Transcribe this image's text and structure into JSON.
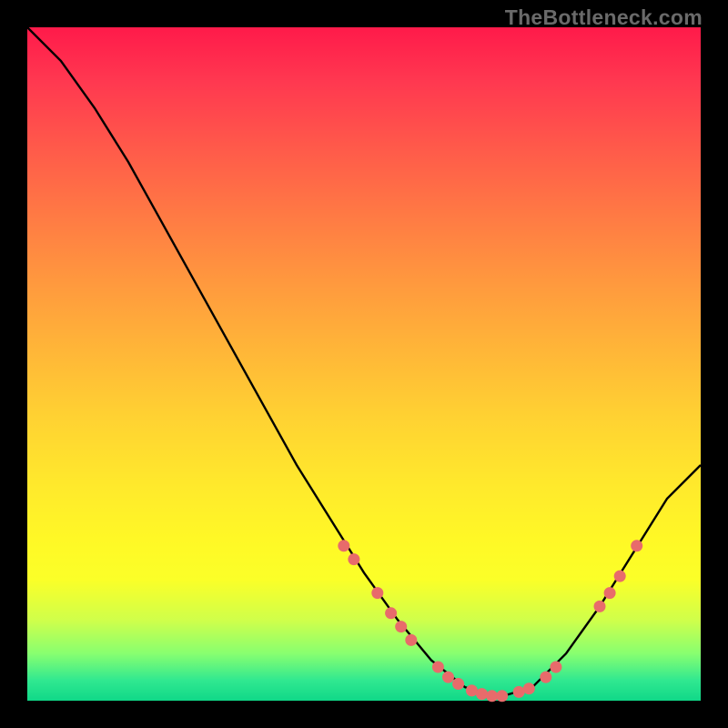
{
  "watermark": "TheBottleneck.com",
  "chart_data": {
    "type": "line",
    "title": "",
    "xlabel": "",
    "ylabel": "",
    "xlim": [
      0,
      100
    ],
    "ylim": [
      0,
      100
    ],
    "curve": [
      {
        "x": 0,
        "y": 100
      },
      {
        "x": 5,
        "y": 95
      },
      {
        "x": 10,
        "y": 88
      },
      {
        "x": 15,
        "y": 80
      },
      {
        "x": 20,
        "y": 71
      },
      {
        "x": 25,
        "y": 62
      },
      {
        "x": 30,
        "y": 53
      },
      {
        "x": 35,
        "y": 44
      },
      {
        "x": 40,
        "y": 35
      },
      {
        "x": 45,
        "y": 27
      },
      {
        "x": 50,
        "y": 19
      },
      {
        "x": 55,
        "y": 12
      },
      {
        "x": 60,
        "y": 6
      },
      {
        "x": 65,
        "y": 2
      },
      {
        "x": 70,
        "y": 0.5
      },
      {
        "x": 75,
        "y": 2
      },
      {
        "x": 80,
        "y": 7
      },
      {
        "x": 85,
        "y": 14
      },
      {
        "x": 90,
        "y": 22
      },
      {
        "x": 95,
        "y": 30
      },
      {
        "x": 100,
        "y": 35
      }
    ],
    "dots": [
      {
        "x": 47,
        "y": 23
      },
      {
        "x": 48.5,
        "y": 21
      },
      {
        "x": 52,
        "y": 16
      },
      {
        "x": 54,
        "y": 13
      },
      {
        "x": 55.5,
        "y": 11
      },
      {
        "x": 57,
        "y": 9
      },
      {
        "x": 61,
        "y": 5
      },
      {
        "x": 62.5,
        "y": 3.5
      },
      {
        "x": 64,
        "y": 2.5
      },
      {
        "x": 66,
        "y": 1.5
      },
      {
        "x": 67.5,
        "y": 1
      },
      {
        "x": 69,
        "y": 0.7
      },
      {
        "x": 70.5,
        "y": 0.7
      },
      {
        "x": 73,
        "y": 1.3
      },
      {
        "x": 74.5,
        "y": 1.8
      },
      {
        "x": 77,
        "y": 3.5
      },
      {
        "x": 78.5,
        "y": 5
      },
      {
        "x": 85,
        "y": 14
      },
      {
        "x": 86.5,
        "y": 16
      },
      {
        "x": 88,
        "y": 18.5
      },
      {
        "x": 90.5,
        "y": 23
      }
    ],
    "dot_color": "#e86b6b",
    "curve_color": "#000000"
  }
}
